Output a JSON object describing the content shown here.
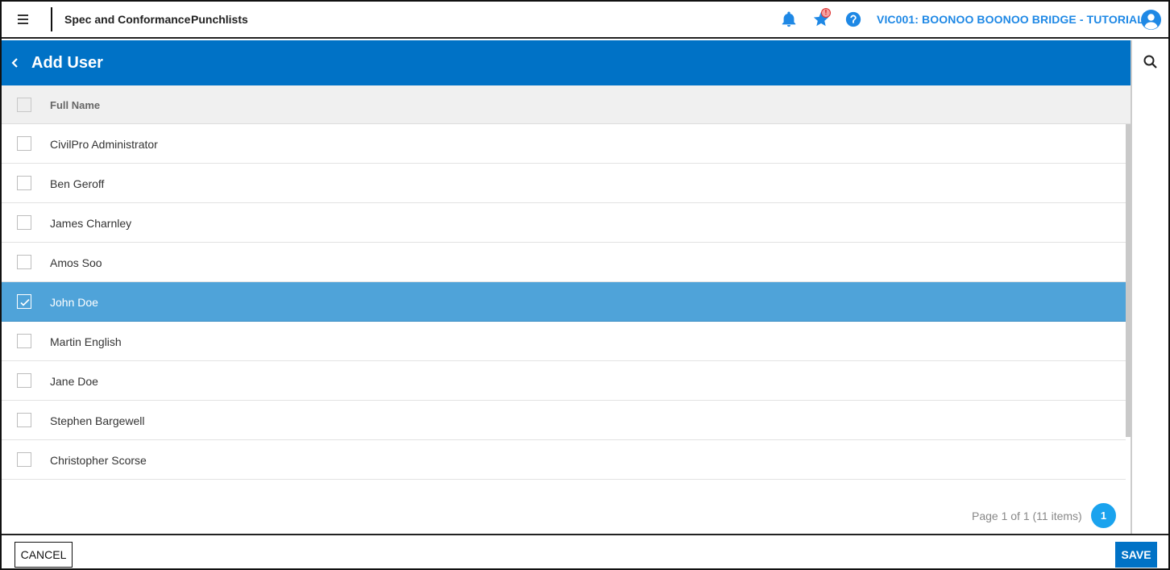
{
  "topbar": {
    "app_title": "Spec and Conformance",
    "app_section": "Punchlists",
    "favorites_badge": "!",
    "project_name": "VIC001: BOONOO BOONOO BRIDGE - TUTORIAL"
  },
  "header": {
    "title": "Add User"
  },
  "table": {
    "column_header": "Full Name",
    "rows": [
      {
        "name": "CivilPro Administrator",
        "selected": false
      },
      {
        "name": "Ben Geroff",
        "selected": false
      },
      {
        "name": "James Charnley",
        "selected": false
      },
      {
        "name": "Amos Soo",
        "selected": false
      },
      {
        "name": "John Doe",
        "selected": true
      },
      {
        "name": "Martin English",
        "selected": false
      },
      {
        "name": "Jane Doe",
        "selected": false
      },
      {
        "name": "Stephen Bargewell",
        "selected": false
      },
      {
        "name": "Christopher Scorse",
        "selected": false
      }
    ]
  },
  "pager": {
    "summary": "Page 1 of 1 (11 items)",
    "current_page": "1"
  },
  "footer": {
    "cancel_label": "CANCEL",
    "save_label": "SAVE"
  },
  "colors": {
    "brand_blue": "#0072c6",
    "selected_row": "#4fa3d9",
    "link_blue": "#1e88e5"
  }
}
